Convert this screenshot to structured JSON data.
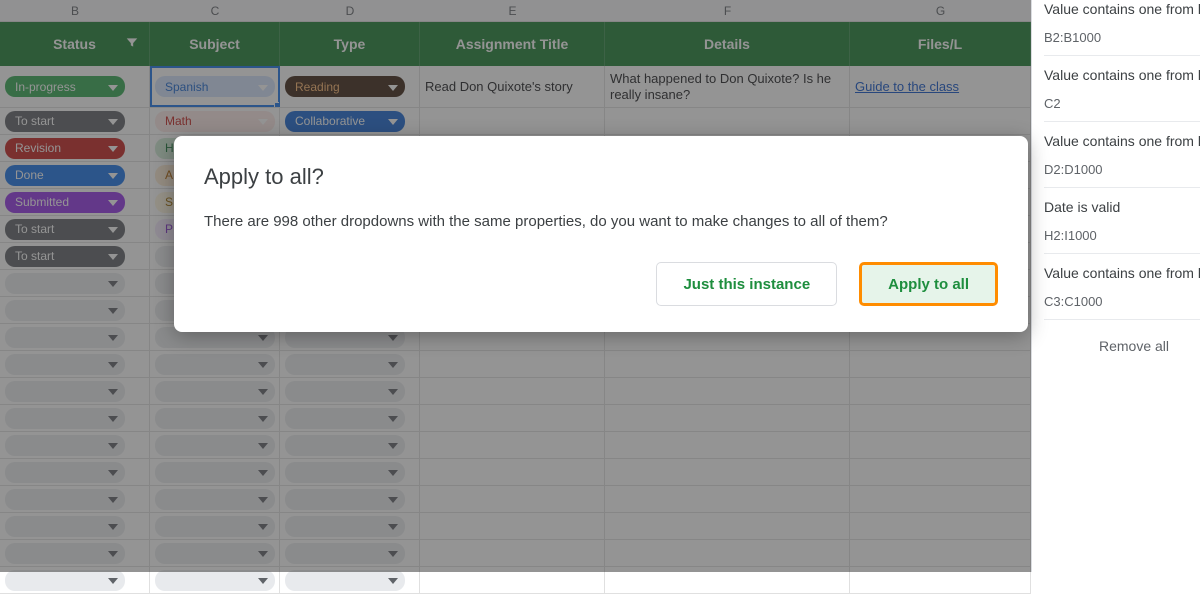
{
  "columns": {
    "letters": [
      "B",
      "C",
      "D",
      "E",
      "F",
      "G"
    ],
    "headers": [
      "Status",
      "Subject",
      "Type",
      "Assignment Title",
      "Details",
      "Files/L"
    ]
  },
  "statusChips": [
    {
      "label": "In-progress",
      "bg": "#34a853"
    },
    {
      "label": "To start",
      "bg": "#5f6368"
    },
    {
      "label": "Revision",
      "bg": "#c5221f"
    },
    {
      "label": "Done",
      "bg": "#1a73e8"
    },
    {
      "label": "Submitted",
      "bg": "#9334e6"
    },
    {
      "label": "To start",
      "bg": "#5f6368"
    },
    {
      "label": "To start",
      "bg": "#5f6368"
    }
  ],
  "subjectChips": [
    {
      "label": "Spanish",
      "bg": "#d2e3fc",
      "fg": "#1967d2",
      "selected": true
    },
    {
      "label": "Math",
      "bg": "#fce8e6",
      "fg": "#c5221f"
    },
    {
      "label": "H",
      "bg": "#ceead6",
      "fg": "#137333"
    },
    {
      "label": "A",
      "bg": "#fdecd2",
      "fg": "#b06000"
    },
    {
      "label": "S",
      "bg": "#fef7e0",
      "fg": "#a06a00"
    },
    {
      "label": "P",
      "bg": "#f3e8fd",
      "fg": "#8430ce"
    }
  ],
  "typeChips": [
    {
      "label": "Reading",
      "bg": "#3c2415",
      "fg": "#ffb870"
    },
    {
      "label": "Collaborative",
      "bg": "#1967d2",
      "fg": "#ffffff"
    }
  ],
  "row1": {
    "assignment": "Read Don Quixote's story",
    "details": "What happened to Don Quixote? Is he really insane?",
    "files": "Guide to the class"
  },
  "dialog": {
    "title": "Apply to all?",
    "body": "There are 998 other dropdowns with the same properties, do you want to make changes to all of them?",
    "just": "Just this instance",
    "apply": "Apply to all"
  },
  "sidebar": {
    "rules": [
      {
        "title": "Value contains one from list",
        "range": "B2:B1000"
      },
      {
        "title": "Value contains one from list",
        "range": "C2"
      },
      {
        "title": "Value contains one from list",
        "range": "D2:D1000"
      },
      {
        "title": "Date is valid",
        "range": "H2:I1000"
      },
      {
        "title": "Value contains one from list",
        "range": "C3:C1000"
      }
    ],
    "removeAll": "Remove all"
  }
}
